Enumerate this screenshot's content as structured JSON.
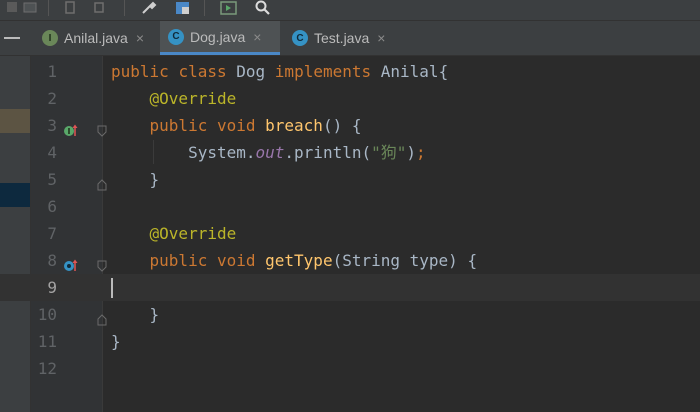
{
  "colors": {
    "background": "#2b2b2b",
    "keyword": "#cc7832",
    "annotation": "#bbb529",
    "method": "#ffc66d",
    "field": "#9876aa",
    "string": "#6a8759",
    "tab_underline": "#4a88c7"
  },
  "toolbar": {
    "icons": [
      "stop-icon",
      "build-icon",
      "rerun-icon",
      "wrench-icon",
      "project-structure-icon",
      "run-coverage-icon",
      "search-icon"
    ]
  },
  "tabs": [
    {
      "label": "Anilal.java",
      "icon": "I",
      "kind": "interface",
      "active": false
    },
    {
      "label": "Dog.java",
      "icon": "C",
      "kind": "class",
      "active": true
    },
    {
      "label": "Test.java",
      "icon": "C",
      "kind": "class",
      "active": false
    }
  ],
  "tab_close_glyph": "×",
  "line_numbers": [
    "1",
    "2",
    "3",
    "4",
    "5",
    "6",
    "7",
    "8",
    "9",
    "10",
    "11",
    "12"
  ],
  "code": {
    "l1_public": "public",
    "l1_class": "class",
    "l1_name": "Dog",
    "l1_implements": "implements",
    "l1_iface": "Anilal{",
    "l2_ann": "@Override",
    "l3_public": "public",
    "l3_void": "void",
    "l3_method": "breach",
    "l3_rest": "() {",
    "l4_sys": "System.",
    "l4_out": "out",
    "l4_println": ".println(",
    "l4_str": "\"狗\"",
    "l4_close": ")",
    "l4_semi": ";",
    "l5_brace": "}",
    "l7_ann": "@Override",
    "l8_public": "public",
    "l8_void": "void",
    "l8_method": "getType",
    "l8_rest": "(String type) {",
    "l10_brace": "}",
    "l11_brace": "}"
  }
}
